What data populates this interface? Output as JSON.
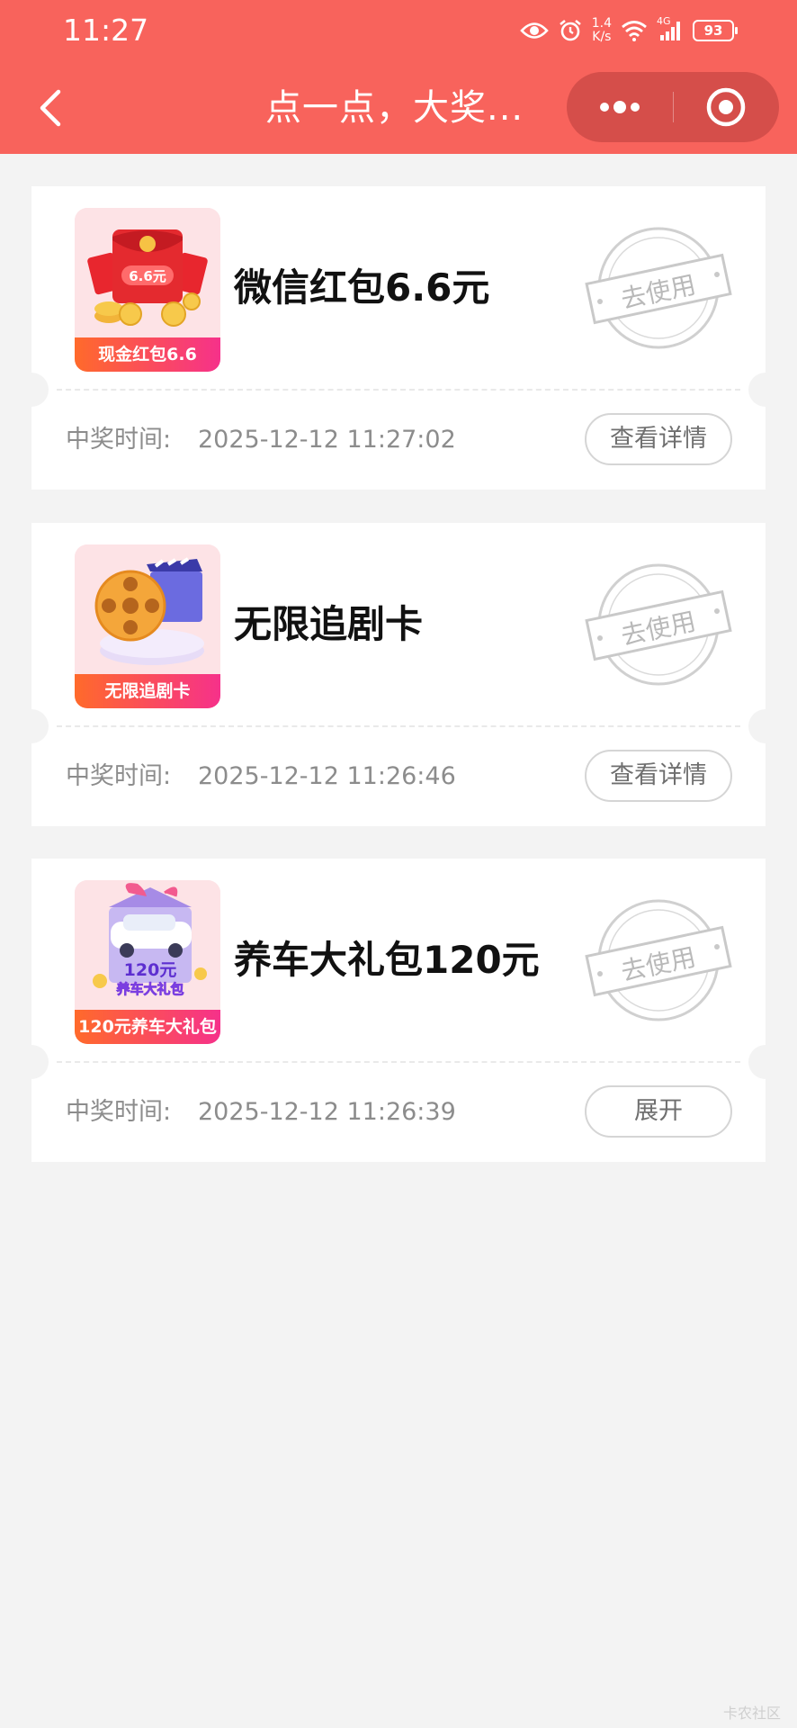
{
  "status_bar": {
    "time": "11:27",
    "net_speed_value": "1.4",
    "net_speed_unit": "K/s",
    "signal_type": "4G",
    "battery": "93"
  },
  "nav": {
    "title": "点一点，大奖..."
  },
  "prizes": [
    {
      "thumb_label": "现金红包6.6",
      "thumb_art_text": "6.6元",
      "name": "微信红包6.6元",
      "stamp": "去使用",
      "time_label": "中奖时间:",
      "time_value": "2025-12-12 11:27:02",
      "action": "查看详情"
    },
    {
      "thumb_label": "无限追剧卡",
      "name": "无限追剧卡",
      "stamp": "去使用",
      "time_label": "中奖时间:",
      "time_value": "2025-12-12 11:26:46",
      "action": "查看详情"
    },
    {
      "thumb_label": "120元养车大礼包",
      "thumb_art_text": "120元",
      "thumb_art_sub": "养车大礼包",
      "name": "养车大礼包120元",
      "stamp": "去使用",
      "time_label": "中奖时间:",
      "time_value": "2025-12-12 11:26:39",
      "action": "展开"
    }
  ],
  "watermark": "卡农社区",
  "colors": {
    "header_bg": "#f8635c",
    "page_bg": "#f3f3f3",
    "thumb_label_start": "#ff6a2b",
    "thumb_label_end": "#f6318a"
  }
}
